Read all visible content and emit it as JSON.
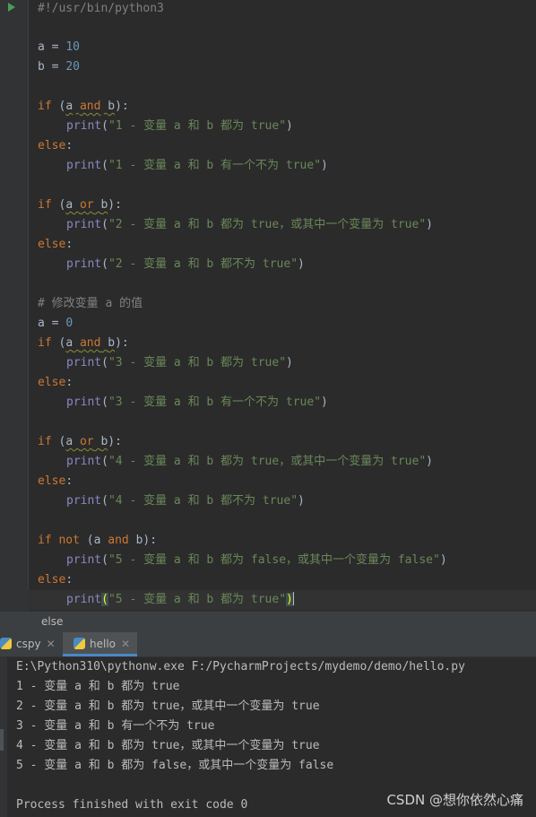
{
  "editor": {
    "shebang": "#!/usr/bin/python3",
    "a_assign": {
      "var": "a",
      "op": " = ",
      "value": "10"
    },
    "b_assign": {
      "var": "b",
      "op": " = ",
      "value": "20"
    },
    "blocks": [
      {
        "cond_kw": "if",
        "cond_pre": " (",
        "cond_a": "a",
        "cond_op": "and",
        "cond_b": "b",
        "cond_post": "):",
        "print_fn": "print",
        "true_str": "\"1 - 变量 a 和 b 都为 true\"",
        "else_kw": "else",
        "false_str": "\"1 - 变量 a 和 b 有一个不为 true\""
      },
      {
        "cond_kw": "if",
        "cond_pre": " (",
        "cond_a": "a",
        "cond_op": "or",
        "cond_b": "b",
        "cond_post": "):",
        "print_fn": "print",
        "true_str": "\"2 - 变量 a 和 b 都为 true，或其中一个变量为 true\"",
        "else_kw": "else",
        "false_str": "\"2 - 变量 a 和 b 都不为 true\""
      }
    ],
    "comment": "# 修改变量 a 的值",
    "a_reassign": {
      "var": "a",
      "op": " = ",
      "value": "0"
    },
    "blocks2": [
      {
        "cond_kw": "if",
        "cond_pre": " (",
        "cond_a": "a",
        "cond_op": "and",
        "cond_b": "b",
        "cond_post": "):",
        "print_fn": "print",
        "true_str": "\"3 - 变量 a 和 b 都为 true\"",
        "else_kw": "else",
        "false_str": "\"3 - 变量 a 和 b 有一个不为 true\""
      },
      {
        "cond_kw": "if",
        "cond_pre": " (",
        "cond_a": "a",
        "cond_op": "or",
        "cond_b": "b",
        "cond_post": "):",
        "print_fn": "print",
        "true_str": "\"4 - 变量 a 和 b 都为 true，或其中一个变量为 true\"",
        "else_kw": "else",
        "false_str": "\"4 - 变量 a 和 b 都不为 true\""
      }
    ],
    "last_block": {
      "if_kw": "if",
      "not_kw": "not",
      "pre": " (a ",
      "and_kw": "and",
      "post": " b):",
      "print_fn": "print",
      "true_str": "\"5 - 变量 a 和 b 都为 false，或其中一个变量为 false\"",
      "else_kw": "else",
      "false_str": "\"5 - 变量 a 和 b 都为 true\"",
      "open_paren": "(",
      "close_paren": ")",
      "colon": ":"
    }
  },
  "breadcrumb": {
    "text": "else"
  },
  "run_tabs": [
    {
      "label": "cspy"
    },
    {
      "label": "hello"
    }
  ],
  "console": {
    "lines": [
      "E:\\Python310\\pythonw.exe F:/PycharmProjects/mydemo/demo/hello.py",
      "1 - 变量 a 和 b 都为 true",
      "2 - 变量 a 和 b 都为 true，或其中一个变量为 true",
      "3 - 变量 a 和 b 有一个不为 true",
      "4 - 变量 a 和 b 都为 true，或其中一个变量为 true",
      "5 - 变量 a 和 b 都为 false，或其中一个变量为 false",
      "",
      "Process finished with exit code 0"
    ]
  },
  "watermark": "CSDN @想你依然心痛",
  "colors": {
    "keyword": "#cc7832",
    "number": "#6897bb",
    "string": "#6a8759",
    "builtin": "#8888c6",
    "comment": "#808080",
    "text": "#a9b7c6",
    "background": "#2b2b2b"
  },
  "icons": [
    "run-icon",
    "python-file-icon",
    "close-icon"
  ]
}
